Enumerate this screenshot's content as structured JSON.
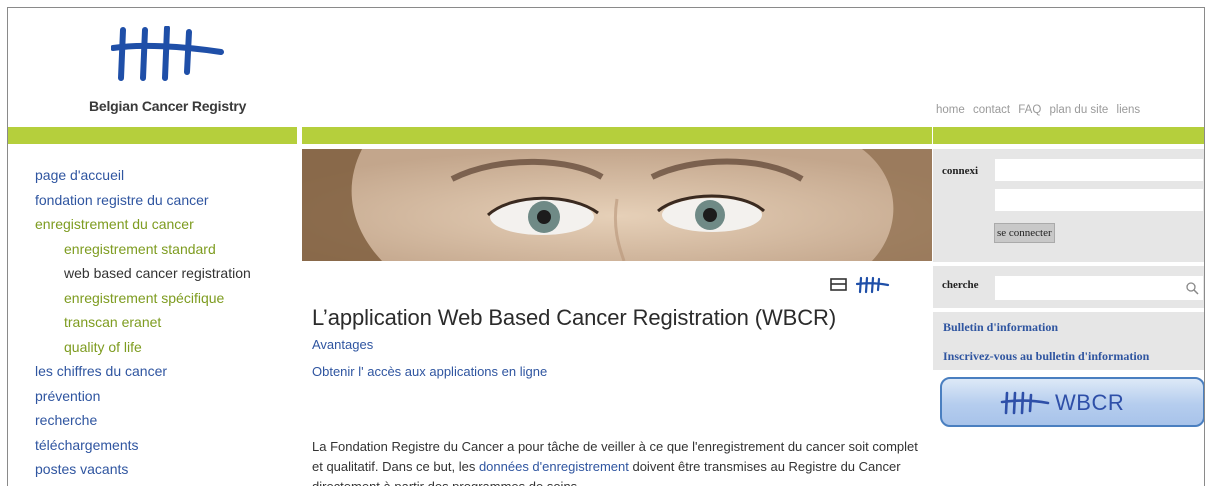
{
  "header": {
    "org_name": "Belgian Cancer Registry",
    "top_nav": [
      "home",
      "contact",
      "FAQ",
      "plan du site",
      "liens"
    ]
  },
  "left_nav": [
    {
      "label": "page d'accueil",
      "level": 1
    },
    {
      "label": "fondation registre du cancer",
      "level": 1
    },
    {
      "label": "enregistrement du cancer",
      "level": 1,
      "active": true
    },
    {
      "label": "enregistrement standard",
      "level": 2
    },
    {
      "label": "web based cancer registration",
      "level": 2,
      "selected": true
    },
    {
      "label": "enregistrement spécifique",
      "level": 2
    },
    {
      "label": "transcan eranet",
      "level": 2
    },
    {
      "label": "quality of life",
      "level": 2
    },
    {
      "label": "les chiffres du cancer",
      "level": 1
    },
    {
      "label": "prévention",
      "level": 1
    },
    {
      "label": "recherche",
      "level": 1
    },
    {
      "label": "téléchargements",
      "level": 1
    },
    {
      "label": "postes vacants",
      "level": 1
    }
  ],
  "content": {
    "title": "L’application Web Based Cancer Registration (WBCR)",
    "links": [
      "Avantages",
      "Obtenir l' accès aux applications en ligne"
    ],
    "para_before": "La Fondation Registre du Cancer a pour tâche de veiller à ce que l'enregistrement du cancer soit complet et qualitatif. Dans ce but, les ",
    "para_link": "données d'enregistrement",
    "para_after": " doivent être transmises au Registre du Cancer directement à partir des programmes de soins."
  },
  "right": {
    "login_label": "connexi",
    "username_value": "",
    "password_value": "",
    "login_button": "se connecter",
    "search_label": "cherche",
    "search_value": "",
    "bulletin_link": "Bulletin d'information",
    "subscribe_link": "Inscrivez-vous au bulletin d'information",
    "wbcr_button": "WBCR"
  },
  "colors": {
    "green_bar": "#b5cf3c",
    "link_blue": "#2f55a0",
    "nav_green": "#7e9c20",
    "right_panel": "#e6e6e6"
  },
  "icons": [
    "bcr-logo-icon",
    "print-icon",
    "bcr-mini-logo-icon",
    "search-icon",
    "wbcr-logo-icon"
  ]
}
